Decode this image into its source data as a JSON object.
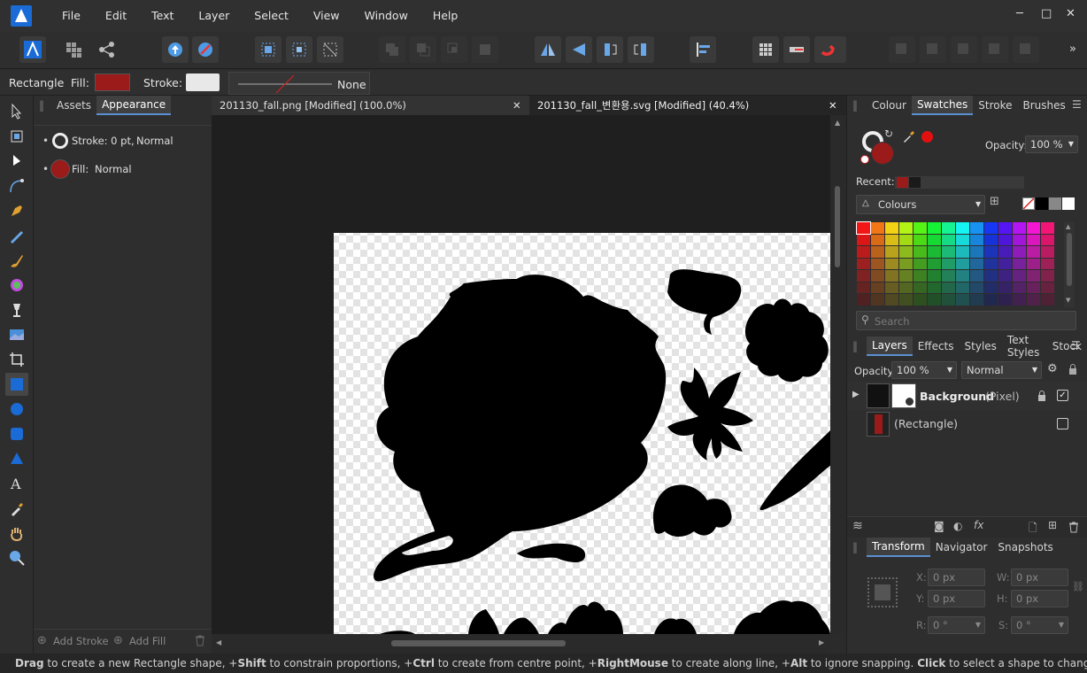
{
  "menu": {
    "items": [
      "File",
      "Edit",
      "Text",
      "Layer",
      "Select",
      "View",
      "Window",
      "Help"
    ]
  },
  "window_controls": {
    "minimize": "─",
    "maximize": "□",
    "close": "✕"
  },
  "context_toolbar": {
    "tool_name": "Rectangle",
    "fill_label": "Fill:",
    "stroke_label": "Stroke:",
    "stroke_style": "None",
    "fill_color": "#9b1a1a",
    "stroke_color": "#e8e8e8"
  },
  "left_panel": {
    "tabs": [
      "Assets",
      "Appearance"
    ],
    "active_tab": "Appearance",
    "stroke_row": {
      "label": "Stroke: 0 pt,",
      "blend": "Normal"
    },
    "fill_row": {
      "label": "Fill:",
      "blend": "Normal"
    },
    "add_stroke": "Add Stroke",
    "add_fill": "Add Fill"
  },
  "documents": [
    {
      "title": "201130_fall.png [Modified] (100.0%)",
      "close": "✕"
    },
    {
      "title": "201130_fall_변환용.svg [Modified] (40.4%)",
      "close": "✕"
    }
  ],
  "colour_panel": {
    "tabs": [
      "Colour",
      "Swatches",
      "Stroke",
      "Brushes"
    ],
    "active_tab": "Swatches",
    "opacity_label": "Opacity:",
    "opacity_value": "100 %",
    "recent_label": "Recent:",
    "palette_name": "Colours",
    "search_placeholder": "Search",
    "fill_color": "#9b1a1a",
    "recent_colors": [
      "#9b1a1a",
      "#1a1a1a"
    ]
  },
  "layers_panel": {
    "tabs": [
      "Layers",
      "Effects",
      "Styles",
      "Text Styles",
      "Stock"
    ],
    "active_tab": "Layers",
    "opacity_label": "Opacity:",
    "opacity_value": "100 %",
    "blend_mode": "Normal",
    "layers": [
      {
        "name": "Background",
        "type": "(Pixel)",
        "locked": true,
        "visible": true
      },
      {
        "name": "(Rectangle)",
        "type": "",
        "locked": false,
        "visible": false
      }
    ]
  },
  "transform_panel": {
    "tabs": [
      "Transform",
      "Navigator",
      "Snapshots"
    ],
    "active_tab": "Transform",
    "x_label": "X:",
    "x_value": "0 px",
    "y_label": "Y:",
    "y_value": "0 px",
    "w_label": "W:",
    "w_value": "0 px",
    "h_label": "H:",
    "h_value": "0 px",
    "r_label": "R:",
    "r_value": "0 °",
    "s_label": "S:",
    "s_value": "0 °"
  },
  "status": {
    "parts": [
      {
        "b": "Drag",
        "t": " to create a new Rectangle shape, +"
      },
      {
        "b": "Shift",
        "t": " to constrain proportions, +"
      },
      {
        "b": "Ctrl",
        "t": " to create from centre point, +"
      },
      {
        "b": "RightMouse",
        "t": " to create along line, +"
      },
      {
        "b": "Alt",
        "t": " to ignore snapping. "
      },
      {
        "b": "Click",
        "t": " to select a shape to change the shape's pa"
      }
    ]
  }
}
